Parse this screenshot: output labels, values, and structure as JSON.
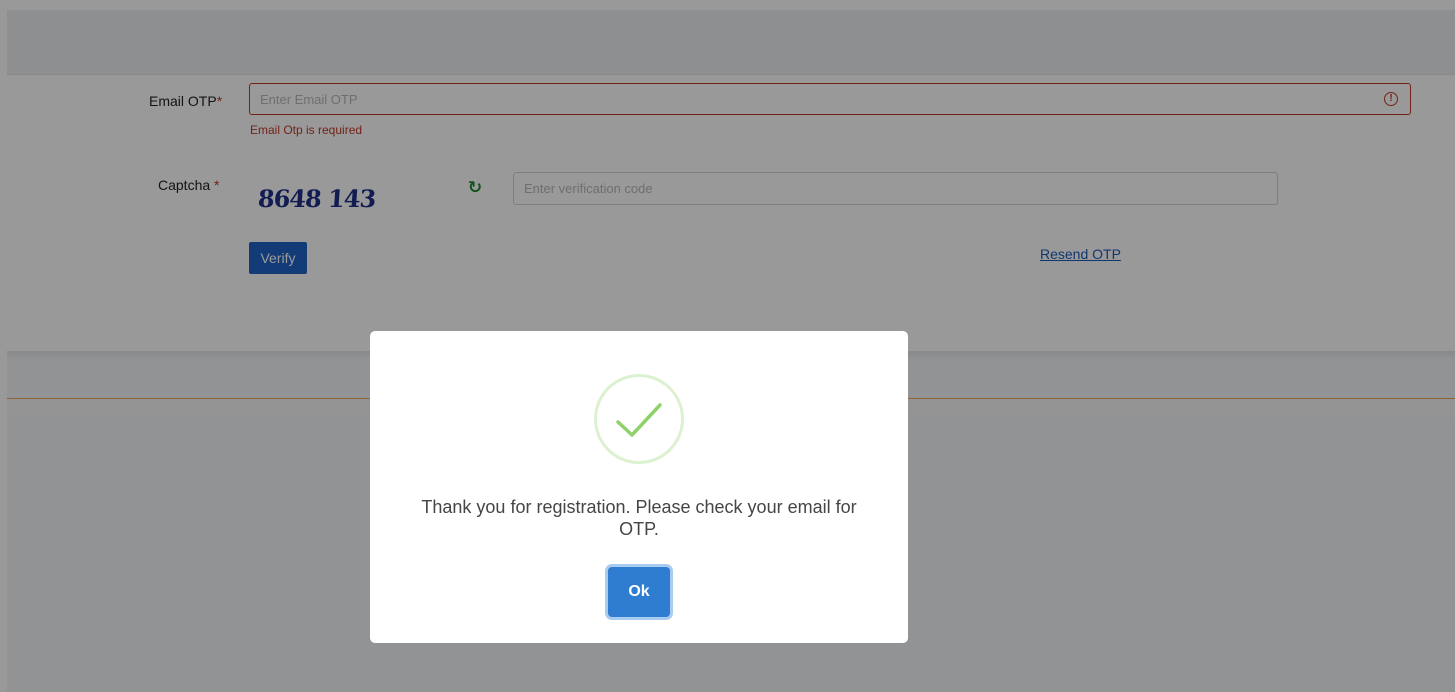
{
  "form": {
    "email_otp_label": "Email OTP",
    "required_mark": "*",
    "email_otp_placeholder": "Enter Email OTP",
    "email_otp_value": "",
    "email_otp_error": "Email Otp is required",
    "captcha_label": "Captcha",
    "captcha_code": "8648 143",
    "captcha_placeholder": "Enter verification code",
    "captcha_value": "",
    "verify_label": "Verify",
    "resend_label": "Resend OTP"
  },
  "modal": {
    "message": "Thank you for registration. Please check your email for OTP.",
    "ok_label": "Ok",
    "icon": "check-circle-icon"
  },
  "colors": {
    "error": "#c0392b",
    "primary_button": "#1e63c9",
    "ok_button": "#2e7dd1",
    "success_check": "#8fd16a",
    "captcha_text": "#1f2f8a",
    "refresh_icon": "#1f8a2d",
    "accent_line": "#f0a45e"
  }
}
